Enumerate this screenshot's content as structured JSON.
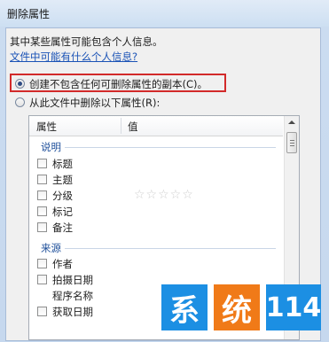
{
  "window": {
    "title": "删除属性"
  },
  "intro": "其中某些属性可能包含个人信息。",
  "link": "文件中可能有什么个人信息?",
  "options": [
    {
      "label": "创建不包含任何可删除属性的副本(C)。",
      "selected": true
    },
    {
      "label": "从此文件中删除以下属性(R):",
      "selected": false
    }
  ],
  "columns": {
    "property": "属性",
    "value": "值"
  },
  "groups": [
    {
      "name": "说明",
      "items": [
        "标题",
        "主题",
        "分级",
        "标记",
        "备注"
      ]
    },
    {
      "name": "来源",
      "items": [
        "作者",
        "拍摄日期",
        "程序名称",
        "获取日期"
      ]
    }
  ],
  "rating_stars": "☆☆☆☆☆",
  "rating_value": 0,
  "watermark": {
    "chars": [
      "系",
      "统",
      "114"
    ],
    "colors": [
      "#1c8fe3",
      "#f07a18",
      "#1c8fe3"
    ]
  }
}
